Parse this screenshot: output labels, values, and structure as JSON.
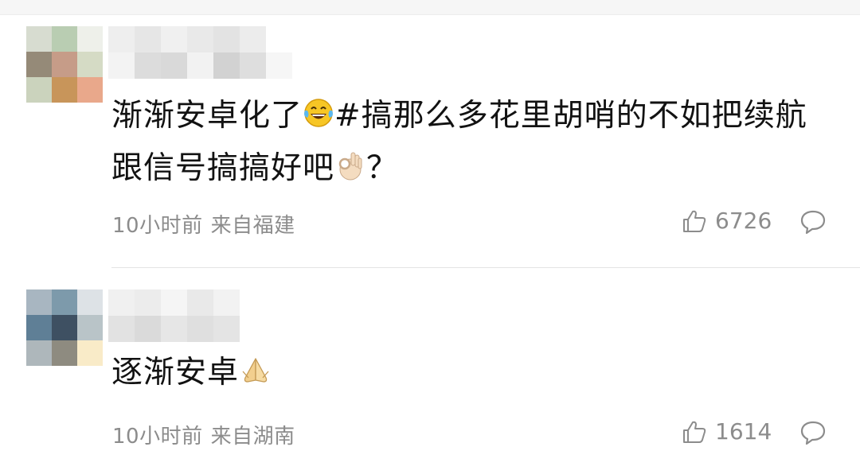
{
  "comments": [
    {
      "username": "",
      "avatar_colors": [
        "#d7dcd0",
        "#b9cdb2",
        "#eef0ea",
        "#958a78",
        "#c69c88",
        "#d5dbc5",
        "#cbd3bd",
        "#c8955a",
        "#e9a88b"
      ],
      "username_colors": [
        "#eeeeee",
        "#f3f3f3",
        "#e6e6e6",
        "#dcdcdc",
        "#f0f0f0",
        "#d9d9d9",
        "#e9e9e9",
        "#f2f2f2",
        "#e3e3e3",
        "#d2d2d2",
        "#ececec",
        "#dedede",
        "#ffffff",
        "#f6f6f6"
      ],
      "text_part1": "渐渐安卓化了",
      "emoji1": "laughing-tears-emoji",
      "text_part2": "#搞那么多花里胡哨的不如把续航跟信号搞搞好吧",
      "emoji2": "ok-hand-emoji",
      "text_part3": "？",
      "time": "10小时前",
      "location": "来自福建",
      "likes": "6726"
    },
    {
      "username": "",
      "avatar_colors": [
        "#a8b6c1",
        "#7d9aab",
        "#dde2e6",
        "#5f7f96",
        "#3e5062",
        "#b9c4c8",
        "#aeb7bb",
        "#8e8b80",
        "#f9ebc8"
      ],
      "username_colors": [
        "#f0f0f0",
        "#e2e2e2",
        "#ececec",
        "#dadada",
        "#f5f5f5",
        "#e6e6e6",
        "#e9e9e9",
        "#dfdfdf",
        "#f2f2f2",
        "#e4e4e4"
      ],
      "text_part1": "逐渐安卓",
      "emoji1": "folded-hands-emoji",
      "time": "10小时前",
      "location": "来自湖南",
      "likes": "1614"
    }
  ],
  "colors": {
    "meta_text": "#8c8c8c",
    "body_text": "#121212",
    "divider": "#e4e4e4"
  }
}
